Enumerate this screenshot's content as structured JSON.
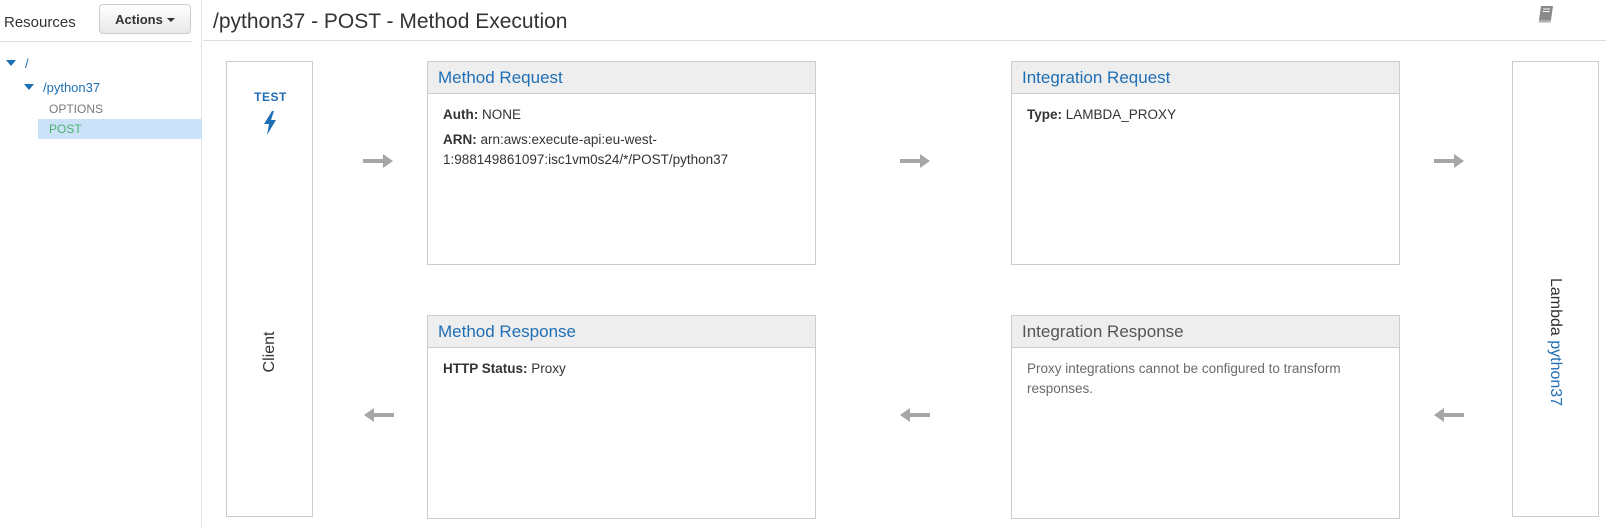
{
  "sidebar": {
    "title": "Resources",
    "actions_label": "Actions",
    "tree": {
      "root": "/",
      "resource": "/python37",
      "methods": [
        "OPTIONS",
        "POST"
      ]
    }
  },
  "header": {
    "title": "/python37 - POST - Method Execution"
  },
  "client": {
    "test_label": "TEST",
    "label": "Client"
  },
  "lambda": {
    "prefix": "Lambda",
    "function": "python37"
  },
  "method_request": {
    "title": "Method Request",
    "auth_key": "Auth:",
    "auth_value": "NONE",
    "arn_key": "ARN:",
    "arn_value": "arn:aws:execute-api:eu-west-1:988149861097:isc1vm0s24/*/POST/python37"
  },
  "integration_request": {
    "title": "Integration Request",
    "type_key": "Type:",
    "type_value": "LAMBDA_PROXY"
  },
  "method_response": {
    "title": "Method Response",
    "status_key": "HTTP Status:",
    "status_value": "Proxy"
  },
  "integration_response": {
    "title": "Integration Response",
    "note": "Proxy integrations cannot be configured to transform responses."
  },
  "colors": {
    "accent": "#1f6fb5",
    "selected_bg": "#cce2f9",
    "selected_text": "#4caf71",
    "arrow": "#a6a6a6"
  },
  "icons": [
    "caret-down-icon",
    "expand-triangle-icon",
    "book-icon",
    "lightning-bolt-icon",
    "arrow-right-icon",
    "arrow-left-icon"
  ]
}
